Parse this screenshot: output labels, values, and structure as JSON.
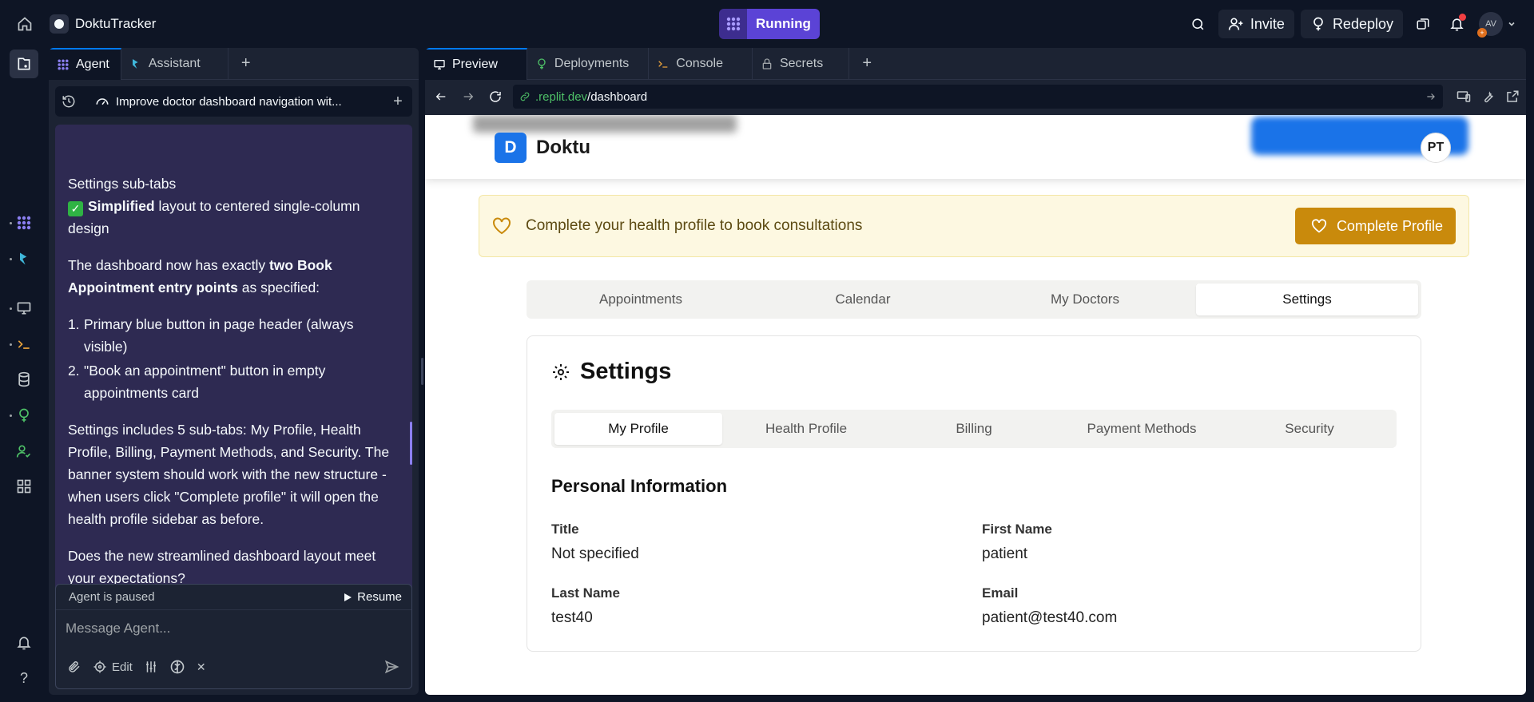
{
  "topbar": {
    "app_name": "DoktuTracker",
    "run_label": "Running",
    "invite_label": "Invite",
    "redeploy_label": "Redeploy",
    "avatar_initials": "AV",
    "accent": "#5b43d6"
  },
  "agent_panel": {
    "tabs": [
      {
        "label": "Agent",
        "active": true
      },
      {
        "label": "Assistant",
        "active": false
      }
    ],
    "thread_title": "Improve doctor dashboard navigation wit...",
    "messages": {
      "line1": "Settings sub-tabs",
      "check_bold": "Simplified",
      "check_rest": " layout to centered single-column design",
      "p2_a": "The dashboard now has exactly ",
      "p2_b": "two Book Appointment entry points",
      "p2_c": " as specified:",
      "list": [
        "Primary blue button in page header (always visible)",
        "\"Book an appointment\" button in empty appointments card"
      ],
      "p3": "Settings includes 5 sub-tabs: My Profile, Health Profile, Billing, Payment Methods, and Security. The banner system should work with the new structure - when users click \"Complete profile\" it will open the health profile sidebar as before.",
      "p4": "Does the new streamlined dashboard layout meet your expectations?"
    },
    "composer": {
      "status": "Agent is paused",
      "resume_label": "Resume",
      "placeholder": "Message Agent...",
      "edit_label": "Edit"
    }
  },
  "preview_panel": {
    "tabs": [
      {
        "label": "Preview",
        "active": true
      },
      {
        "label": "Deployments",
        "active": false
      },
      {
        "label": "Console",
        "active": false
      },
      {
        "label": "Secrets",
        "active": false
      }
    ],
    "url_host": ".replit.dev",
    "url_path": "/dashboard"
  },
  "webapp": {
    "brand_letter": "D",
    "brand_name": "Doktu",
    "user_initials": "PT",
    "banner_text": "Complete your health profile to book consultations",
    "banner_button": "Complete Profile",
    "main_tabs": [
      "Appointments",
      "Calendar",
      "My Doctors",
      "Settings"
    ],
    "active_main_tab": "Settings",
    "settings_title": "Settings",
    "sub_tabs": [
      "My Profile",
      "Health Profile",
      "Billing",
      "Payment Methods",
      "Security"
    ],
    "active_sub_tab": "My Profile",
    "section_title": "Personal Information",
    "fields": [
      {
        "label": "Title",
        "value": "Not specified"
      },
      {
        "label": "First Name",
        "value": "patient"
      },
      {
        "label": "Last Name",
        "value": "test40"
      },
      {
        "label": "Email",
        "value": "patient@test40.com"
      }
    ]
  }
}
